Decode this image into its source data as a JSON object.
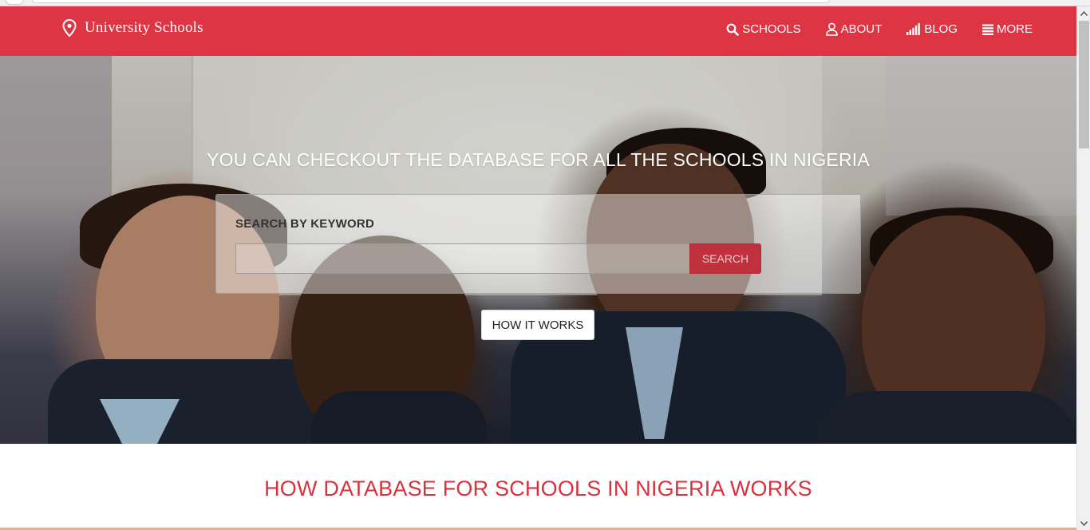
{
  "brand": {
    "name": "University Schools",
    "icon": "map-pin-icon"
  },
  "nav": {
    "items": [
      {
        "label": "SCHOOLS",
        "icon": "search-icon"
      },
      {
        "label": "ABOUT",
        "icon": "user-icon"
      },
      {
        "label": "BLOG",
        "icon": "signal-bars-icon"
      },
      {
        "label": "MORE",
        "icon": "menu-icon"
      }
    ]
  },
  "hero": {
    "title": "YOU CAN CHECKOUT THE DATABASE FOR ALL THE SCHOOLS IN NIGERIA",
    "search": {
      "label": "SEARCH BY KEYWORD",
      "value": "",
      "placeholder": "",
      "button_label": "SEARCH"
    },
    "how_button_label": "HOW IT WORKS"
  },
  "section": {
    "title": "HOW DATABASE FOR SCHOOLS IN NIGERIA WORKS"
  },
  "colors": {
    "navbar": "#de3545",
    "accent_text": "#d9323f",
    "search_button": "#c0303d"
  }
}
